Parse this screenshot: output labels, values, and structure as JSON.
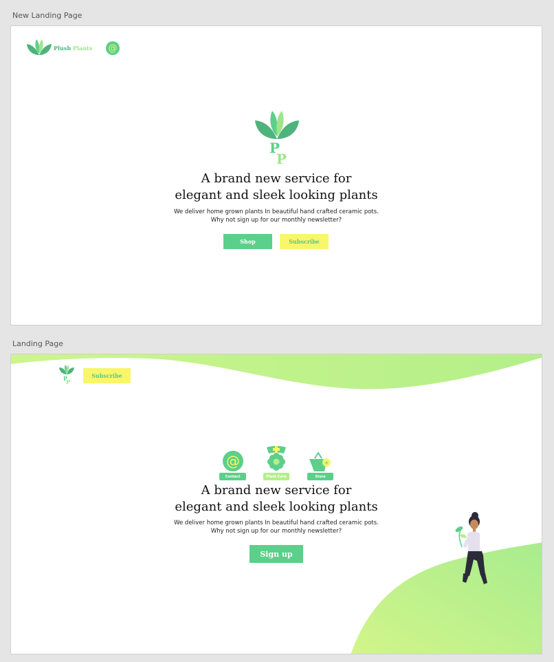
{
  "frames": [
    {
      "label": "New Landing Page",
      "brand": {
        "part1": "Plush",
        "part2": "Plants"
      },
      "at_symbol": "@",
      "headline": [
        "A brand new service for",
        "elegant and sleek looking plants"
      ],
      "subtext": [
        "We deliver home grown plants In beautiful hand crafted ceramic pots.",
        "Why not sign up for our monthly newsletter?"
      ],
      "buttons": {
        "shop": "Shop",
        "subscribe": "Subscribe"
      }
    },
    {
      "label": "Landing Page",
      "subscribe": "Subscribe",
      "icons": [
        {
          "label": "Contact",
          "icon": "at-icon",
          "symbol": "@"
        },
        {
          "label": "Plant Care",
          "icon": "plant-care-icon"
        },
        {
          "label": "Store",
          "icon": "store-icon"
        }
      ],
      "headline": [
        "A brand new service for",
        "elegant and sleek looking plants"
      ],
      "subtext": [
        "We deliver home grown plants In beautiful hand crafted ceramic pots.",
        "Why not sign up for our monthly newsletter?"
      ],
      "signup": "Sign up"
    }
  ],
  "colors": {
    "green": "#5ccf8a",
    "dark_green": "#4fb37c",
    "light_green": "#b4ef8a",
    "yellow": "#f8f66a",
    "canvas": "#e5e5e5"
  }
}
